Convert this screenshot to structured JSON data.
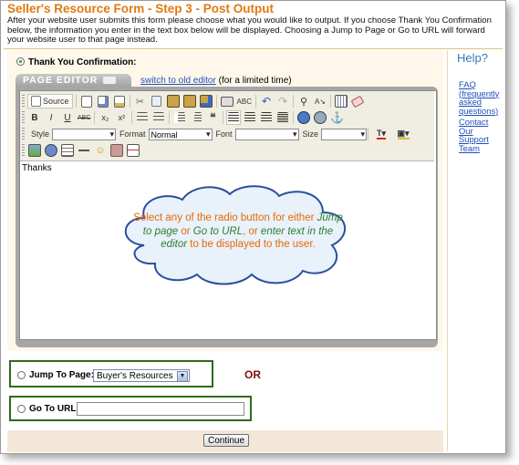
{
  "page": {
    "title": "Seller's Resource Form - Step 3 - Post Output",
    "intro": "After your website user submits this form please choose what you would like to output. If you choose Thank You Confirmation below, the information you enter in the text box below will be displayed. Choosing a Jump to Page or Go to URL will forward your website user to that page instead."
  },
  "thank_you": {
    "label": "Thank You Confirmation:",
    "selected": true
  },
  "editor": {
    "tab_label": "PAGE EDITOR",
    "switch_link": "switch to old editor",
    "switch_note": "(for a limited time)",
    "source_label": "Source",
    "style_label": "Style",
    "format_label": "Format",
    "format_value": "Normal",
    "font_label": "Font",
    "size_label": "Size",
    "content": "Thanks"
  },
  "callout": {
    "t1": "Select any of the radio button for either ",
    "e1": "Jump to page",
    "t2": " or ",
    "e2": "Go to URL",
    "t3": ", or ",
    "e3": "enter text in the editor",
    "t4": " to be displayed to the user."
  },
  "jump": {
    "label": "Jump To Page:",
    "selected_option": "Buyer's Resources"
  },
  "or_text": "OR",
  "url": {
    "label": "Go To URL:",
    "value": ""
  },
  "continue_label": "Continue",
  "sidebar": {
    "help_title": "Help?",
    "link1": "FAQ (frequently asked questions)",
    "link2": "Contact Our Support Team"
  },
  "colors": {
    "title": "#e07a10",
    "callout_text": "#e46b00",
    "callout_emphasis": "#2e7d2e",
    "highlight_border": "#2e6b1e",
    "or": "#7a1010"
  }
}
